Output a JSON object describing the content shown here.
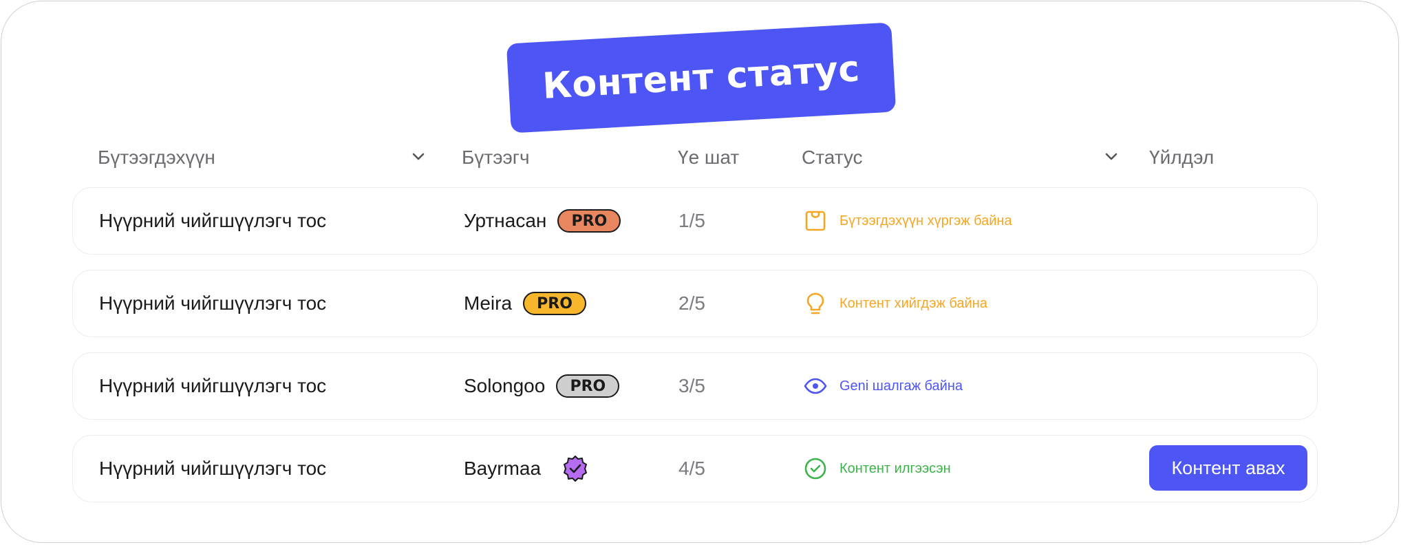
{
  "banner": {
    "title": "Контент статус"
  },
  "header": {
    "product": "Бүтээгдэхүүн",
    "creator": "Бүтээгч",
    "stage": "Үе шат",
    "status": "Статус",
    "action": "Үйлдэл"
  },
  "rows": [
    {
      "product": "Нүүрний чийгшүүлэгч тос",
      "creator": "Уртнасан",
      "badge": "PRO",
      "badge_color": "#e8865f",
      "stage": "1/5",
      "status": "Бүтээгдэхүүн хүргэж байна",
      "status_color": "#f5a623",
      "status_icon": "package-icon"
    },
    {
      "product": "Нүүрний чийгшүүлэгч тос",
      "creator": "Meira",
      "badge": "PRO",
      "badge_color": "#f8b62d",
      "stage": "2/5",
      "status": "Контент хийгдэж байна",
      "status_color": "#f5a623",
      "status_icon": "lightbulb-icon"
    },
    {
      "product": "Нүүрний чийгшүүлэгч тос",
      "creator": "Solongoo",
      "badge": "PRO",
      "badge_color": "#cfcfcf",
      "stage": "3/5",
      "status": "Geni шалгаж байна",
      "status_color": "#4d55f5",
      "status_icon": "eye-icon"
    },
    {
      "product": "Нүүрний чийгшүүлэгч тос",
      "creator": "Bayrmaa",
      "badge_icon": "verified-badge-icon",
      "badge_color": "#b56cf0",
      "stage": "4/5",
      "status": "Контент илгээсэн",
      "status_color": "#3cb44a",
      "status_icon": "check-circle-icon",
      "action_label": "Контент авах"
    }
  ],
  "colors": {
    "accent": "#4d55f5"
  }
}
